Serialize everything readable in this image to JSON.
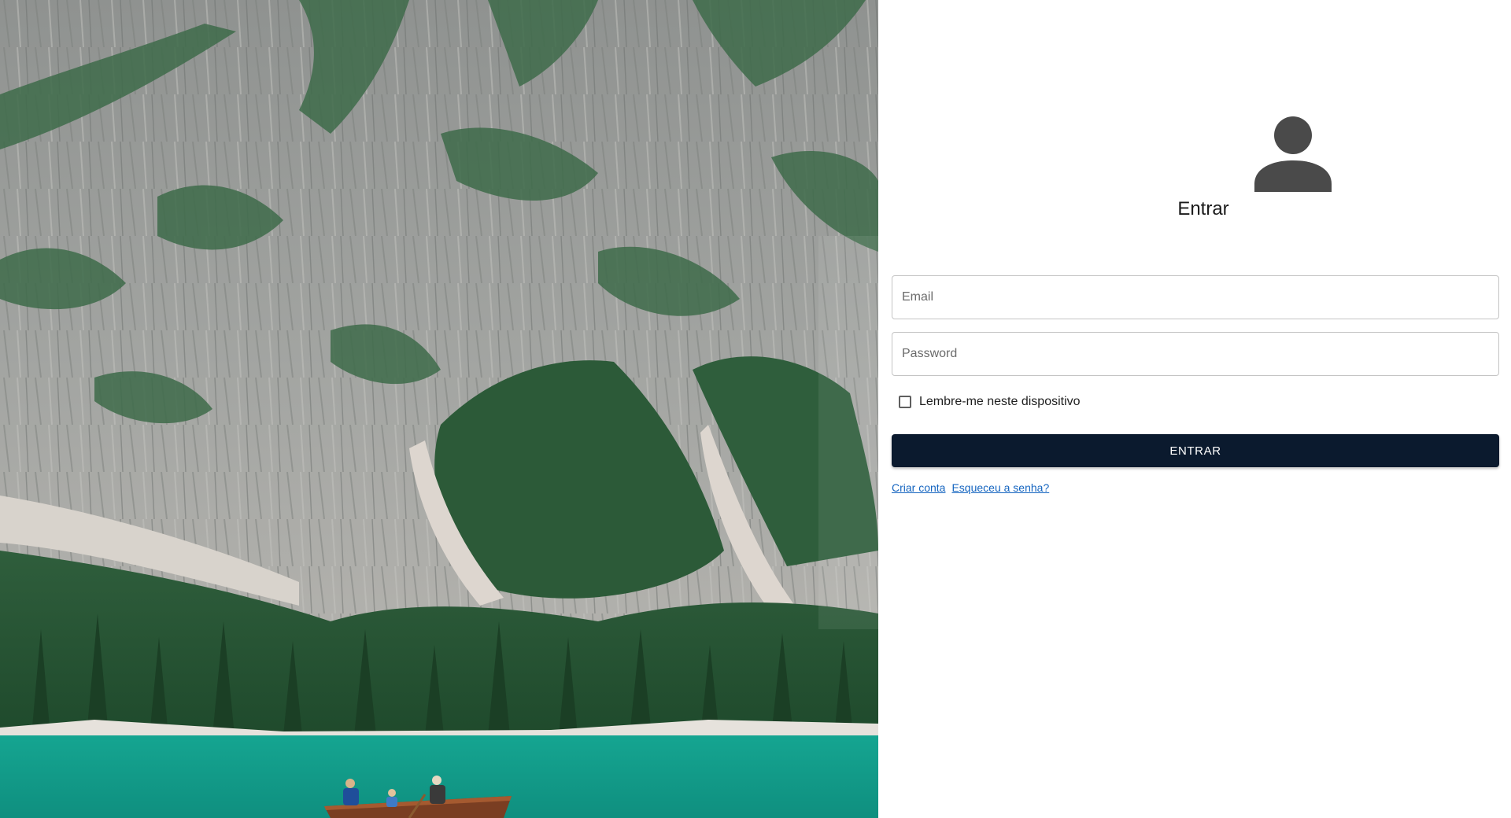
{
  "hero": {
    "description_icon": "mountain-lake-photo"
  },
  "login": {
    "avatar_icon": "person-icon",
    "title": "Entrar",
    "email_placeholder": "Email",
    "email_value": "",
    "password_placeholder": "Password",
    "password_value": "",
    "remember_label": "Lembre-me neste dispositivo",
    "remember_checked": false,
    "submit_label": "ENTRAR",
    "links": {
      "create_account": "Criar conta",
      "forgot_password": "Esqueceu a senha?"
    }
  },
  "colors": {
    "button_bg": "#0b1a2e",
    "link": "#1565c0",
    "avatar": "#4a4a4a"
  }
}
